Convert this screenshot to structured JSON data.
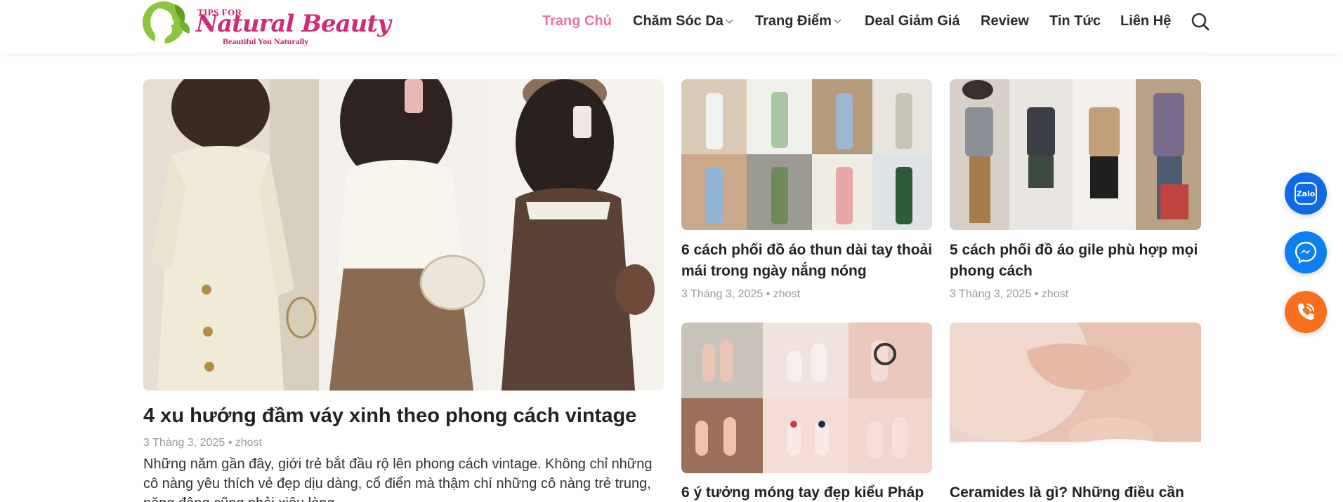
{
  "header": {
    "logo": {
      "tips": "TIPS FOR",
      "brand": "Natural Beauty",
      "tagline": "Beautiful You Naturally"
    },
    "nav": [
      {
        "label": "Trang Chủ",
        "active": true,
        "dropdown": false
      },
      {
        "label": "Chăm Sóc Da",
        "active": false,
        "dropdown": true
      },
      {
        "label": "Trang Điểm",
        "active": false,
        "dropdown": true
      },
      {
        "label": "Deal Giảm Giá",
        "active": false,
        "dropdown": false
      },
      {
        "label": "Review",
        "active": false,
        "dropdown": false
      },
      {
        "label": "Tin Tức",
        "active": false,
        "dropdown": false
      },
      {
        "label": "Liên Hệ",
        "active": false,
        "dropdown": false
      }
    ],
    "search_icon": "search-icon"
  },
  "featured": {
    "title": "4 xu hướng đầm váy xinh theo phong cách vintage",
    "date": "3 Tháng 3, 2025",
    "author": "zhost",
    "excerpt": "Những năm gần đây, giới trẻ bắt đầu rộ lên phong cách vintage. Không chỉ những cô nàng yêu thích vẻ đẹp dịu dàng, cổ điển mà thậm chí những cô nàng trẻ trung, năng động cũng phải xiêu lòng."
  },
  "posts": [
    {
      "title": "6 cách phối đồ áo thun dài tay thoải mái trong ngày nắng nóng",
      "date": "3 Tháng 3, 2025",
      "author": "zhost"
    },
    {
      "title": "5 cách phối đồ áo gile phù hợp mọi phong cách",
      "date": "3 Tháng 3, 2025",
      "author": "zhost"
    },
    {
      "title": "6 ý tưởng móng tay đẹp kiểu Pháp",
      "date": "",
      "author": ""
    },
    {
      "title": "Ceramides là gì? Những điều cần",
      "date": "",
      "author": ""
    }
  ],
  "meta_separator": "•",
  "floating": {
    "zalo_label": "Zalo",
    "zalo_icon": "zalo-icon",
    "messenger_icon": "messenger-icon",
    "phone_icon": "phone-icon"
  },
  "colors": {
    "accent_pink": "#e7769f",
    "zalo_blue": "#0f6ae8",
    "messenger_blue": "#0c7ff2",
    "phone_orange": "#f7701e"
  }
}
